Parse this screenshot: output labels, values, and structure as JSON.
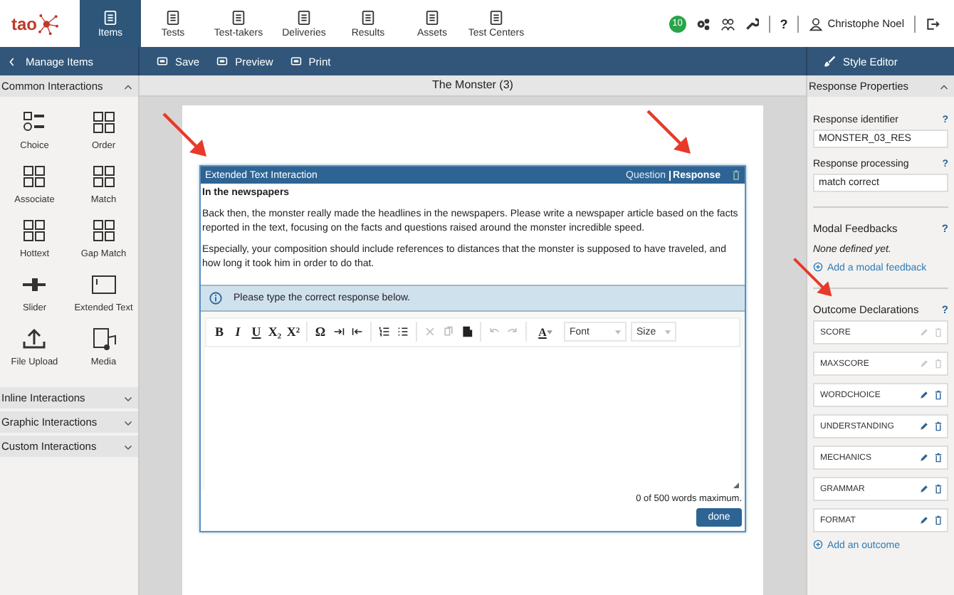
{
  "nav": {
    "logo": "tao",
    "badge": "10",
    "help": "?",
    "user": "Christophe Noel",
    "tabs": [
      {
        "label": "Items",
        "selected": true
      },
      {
        "label": "Tests",
        "selected": false
      },
      {
        "label": "Test-takers",
        "selected": false
      },
      {
        "label": "Deliveries",
        "selected": false
      },
      {
        "label": "Results",
        "selected": false
      },
      {
        "label": "Assets",
        "selected": false
      },
      {
        "label": "Test Centers",
        "selected": false
      }
    ]
  },
  "action_bar": {
    "back": "Manage Items",
    "actions": [
      "Save",
      "Preview",
      "Print"
    ],
    "style_editor": "Style Editor"
  },
  "sidebar": {
    "sections": [
      {
        "title": "Common Interactions",
        "expanded": true,
        "items": [
          {
            "label": "Choice",
            "kind": "choice"
          },
          {
            "label": "Order",
            "kind": "order"
          },
          {
            "label": "Associate",
            "kind": "associate"
          },
          {
            "label": "Match",
            "kind": "match"
          },
          {
            "label": "Hottext",
            "kind": "hottext"
          },
          {
            "label": "Gap Match",
            "kind": "gapmatch"
          },
          {
            "label": "Slider",
            "kind": "slider"
          },
          {
            "label": "Extended Text",
            "kind": "extended"
          },
          {
            "label": "File Upload",
            "kind": "upload"
          },
          {
            "label": "Media",
            "kind": "media"
          }
        ]
      },
      {
        "title": "Inline Interactions",
        "expanded": false
      },
      {
        "title": "Graphic Interactions",
        "expanded": false
      },
      {
        "title": "Custom Interactions",
        "expanded": false
      }
    ]
  },
  "item_title": "The Monster (3)",
  "interaction": {
    "title": "Extended Text Interaction",
    "modes": [
      {
        "label": "Question",
        "selected": false
      },
      {
        "label": "Response",
        "selected": true
      }
    ],
    "heading": "In the newspapers",
    "paragraphs": [
      "Back then, the monster really made the headlines in the newspapers. Please write a newspaper article based on the facts reported in the text, focusing on the facts and questions raised around the monster incredible speed.",
      "Especially, your composition should include references to distances that the monster is supposed to have traveled, and how long it took him in order to do that."
    ],
    "info": "Please type the correct response below.",
    "toolbar": [
      {
        "kind": "text",
        "label": "B",
        "disabled": false
      },
      {
        "kind": "text",
        "label": "I",
        "disabled": false
      },
      {
        "kind": "text",
        "label": "U",
        "disabled": false
      },
      {
        "kind": "text",
        "label": "X₂",
        "disabled": false
      },
      {
        "kind": "text",
        "label": "X²",
        "disabled": false
      },
      {
        "kind": "sep"
      },
      {
        "kind": "text",
        "label": "Ω",
        "disabled": false
      },
      {
        "kind": "indent",
        "disabled": false
      },
      {
        "kind": "outdent",
        "disabled": false
      },
      {
        "kind": "sep"
      },
      {
        "kind": "numlist",
        "disabled": false
      },
      {
        "kind": "bullist",
        "disabled": false
      },
      {
        "kind": "sep"
      },
      {
        "kind": "cut",
        "disabled": true
      },
      {
        "kind": "copy",
        "disabled": true
      },
      {
        "kind": "paste",
        "disabled": false
      },
      {
        "kind": "sep"
      },
      {
        "kind": "undo",
        "disabled": true
      },
      {
        "kind": "redo",
        "disabled": true
      },
      {
        "kind": "sep"
      },
      {
        "kind": "color",
        "label": "A",
        "disabled": false
      },
      {
        "kind": "select",
        "label": "Font"
      },
      {
        "kind": "select",
        "label": "Size"
      }
    ],
    "word_count": "0 of 500 words maximum.",
    "done": "done"
  },
  "properties": {
    "title": "Response Properties",
    "help": "?",
    "identifier": {
      "label": "Response identifier",
      "value": "MONSTER_03_RES"
    },
    "processing": {
      "label": "Response processing",
      "value": "match correct"
    },
    "feedbacks": {
      "label": "Modal Feedbacks",
      "empty": "None defined yet.",
      "add": "Add a modal feedback"
    },
    "outcomes": {
      "label": "Outcome Declarations",
      "add": "Add an outcome",
      "items": [
        {
          "name": "SCORE",
          "disabled": true
        },
        {
          "name": "MAXSCORE",
          "disabled": true
        },
        {
          "name": "WORDCHOICE",
          "disabled": false
        },
        {
          "name": "UNDERSTANDING",
          "disabled": false
        },
        {
          "name": "MECHANICS",
          "disabled": false
        },
        {
          "name": "GRAMMAR",
          "disabled": false
        },
        {
          "name": "FORMAT",
          "disabled": false
        }
      ]
    }
  }
}
